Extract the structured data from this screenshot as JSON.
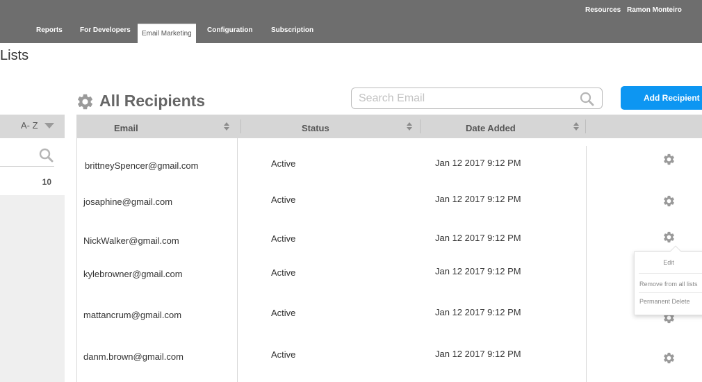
{
  "header": {
    "utility_links": [
      "Resources",
      "Ramon Monteiro"
    ],
    "nav_tabs": [
      {
        "label": "Reports",
        "active": false
      },
      {
        "label": "For Developers",
        "active": false
      },
      {
        "label": "Email Marketing",
        "active": true
      },
      {
        "label": "Configuration",
        "active": false
      },
      {
        "label": "Subscription",
        "active": false
      }
    ]
  },
  "page": {
    "title": "Lists"
  },
  "left_panel": {
    "sort_label": "A- Z",
    "count": "10"
  },
  "section": {
    "title": "All Recipients",
    "icon": "gear-icon"
  },
  "search": {
    "placeholder": "Search Email",
    "value": ""
  },
  "add_button": {
    "label": "Add Recipient"
  },
  "table": {
    "columns": [
      "Email",
      "Status",
      "Date Added"
    ],
    "rows": [
      {
        "email": "brittneySpencer@gmail.com",
        "status": "Active",
        "date_added": "Jan 12 2017 9:12 PM"
      },
      {
        "email": "josaphine@gmail.com",
        "status": "Active",
        "date_added": "Jan 12 2017 9:12 PM"
      },
      {
        "email": "NickWalker@gmail.com",
        "status": "Active",
        "date_added": "Jan 12 2017 9:12 PM"
      },
      {
        "email": "kylebrowner@gmail.com",
        "status": "Active",
        "date_added": "Jan 12 2017 9:12 PM"
      },
      {
        "email": "mattancrum@gmail.com",
        "status": "Active",
        "date_added": "Jan 12 2017 9:12 PM"
      },
      {
        "email": "danm.brown@gmail.com",
        "status": "Active",
        "date_added": "Jan 12 2017 9:12 PM"
      }
    ]
  },
  "row_menu": {
    "items": [
      "Edit",
      "Remove from all lists",
      "Permanent Delete"
    ]
  },
  "colors": {
    "topbar": "#6e6e6e",
    "accent": "#0d96f2",
    "table_header": "#d6d6d6",
    "left_panel": "#efefef",
    "icon_gray": "#9a9a9a"
  }
}
